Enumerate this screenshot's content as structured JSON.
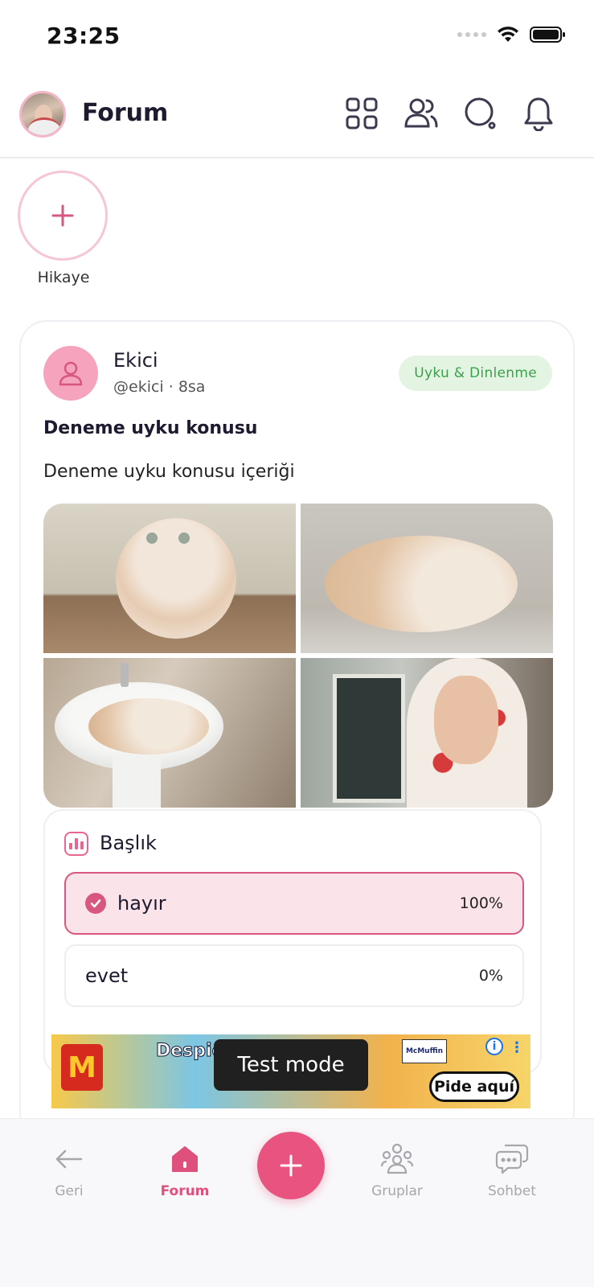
{
  "status_bar": {
    "time": "23:25"
  },
  "header": {
    "title": "Forum",
    "icons": [
      "grid-icon",
      "users-icon",
      "search-icon",
      "bell-icon"
    ]
  },
  "stories": {
    "add_label": "Hikaye"
  },
  "post": {
    "author_name": "Ekici",
    "author_meta": "@ekici · 8sa",
    "category": "Uyku & Dinlenme",
    "title": "Deneme uyku konusu",
    "body": "Deneme uyku konusu içeriği",
    "poll": {
      "title": "Başlık",
      "options": [
        {
          "label": "hayır",
          "percent": "100%",
          "selected": true
        },
        {
          "label": "evet",
          "percent": "0%",
          "selected": false
        }
      ]
    }
  },
  "ad": {
    "headline": "Despierta el Verano",
    "product": "McMuffin",
    "cta": "Pide aquí",
    "badge": "Test mode"
  },
  "bottom_nav": {
    "items": [
      {
        "label": "Geri",
        "icon": "arrow-left-icon"
      },
      {
        "label": "Forum",
        "icon": "home-icon",
        "active": true
      },
      {
        "label": "Gruplar",
        "icon": "groups-icon"
      },
      {
        "label": "Sohbet",
        "icon": "chat-icon"
      }
    ]
  },
  "colors": {
    "accent": "#e8537f",
    "tag_text": "#3aa14a",
    "tag_bg": "#e3f4e3",
    "poll_selected_bg": "#fbe3ea"
  }
}
